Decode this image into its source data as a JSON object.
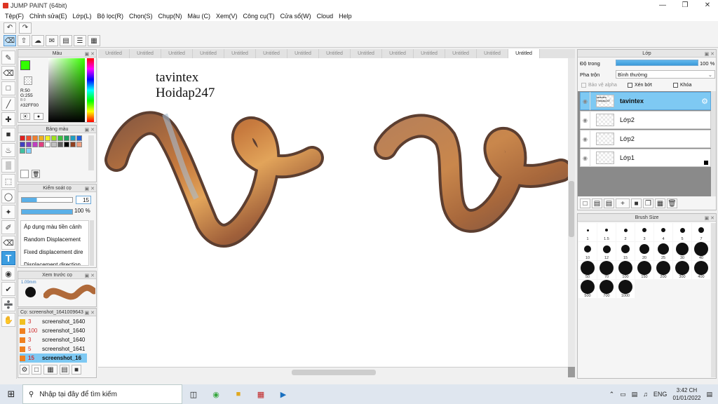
{
  "window": {
    "title": "JUMP PAINT (64bit)"
  },
  "menu": [
    "Tệp(F)",
    "Chỉnh sửa(E)",
    "Lớp(L)",
    "Bộ lọc(R)",
    "Chọn(S)",
    "Chụp(N)",
    "Màu (C)",
    "Xem(V)",
    "Công cụ(T)",
    "Cửa sổ(W)",
    "Cloud",
    "Help"
  ],
  "colorPanel": {
    "title": "Màu",
    "r": "R:50",
    "g": "G:255",
    "b": "B:0",
    "hex": "#32FF00"
  },
  "swatchPanel": {
    "title": "Bảng màu",
    "swatches": [
      "#e02020",
      "#f05030",
      "#f08030",
      "#f0b020",
      "#f0f020",
      "#a0e020",
      "#40c040",
      "#20a060",
      "#20a0c0",
      "#2060e0",
      "#4040c0",
      "#8040c0",
      "#c040c0",
      "#e04080",
      "#ffffff",
      "#c0c0c0",
      "#606060",
      "#000000",
      "#904020",
      "#f0a080",
      "#40c0a0",
      "#80d0ff"
    ]
  },
  "brushControl": {
    "title": "Kiểm soát cọ",
    "size": "15",
    "opacity": "100 %",
    "options": [
      "Áp dụng màu tiền cảnh",
      "Random Displacement",
      "Fixed displacement dire",
      "Displacement direction"
    ]
  },
  "brushPreview": {
    "title": "Xem trước cọ",
    "size": "1.09mm"
  },
  "brushList": {
    "title": "Cọ: screenshot_1641009643",
    "items": [
      {
        "num": "3",
        "name": "screenshot_1640"
      },
      {
        "num": "100",
        "name": "screenshot_1640"
      },
      {
        "num": "3",
        "name": "screenshot_1640"
      },
      {
        "num": "5",
        "name": "screenshot_1641"
      },
      {
        "num": "15",
        "name": "screenshot_16"
      }
    ]
  },
  "tabs": [
    "Untitled",
    "Untitled",
    "Untitled",
    "Untitled",
    "Untitled",
    "Untitled",
    "Untitled",
    "Untitled",
    "Untitled",
    "Untitled",
    "Untitled",
    "Untitled",
    "Untitled",
    "Untitled"
  ],
  "canvas": {
    "line1": "tavintex",
    "line2": "Hoidap247"
  },
  "layerPanel": {
    "title": "Lớp",
    "opacityLabel": "Độ trong",
    "opacityValue": "100 %",
    "blendLabel": "Pha trộn",
    "blendValue": "Bình thường",
    "protectAlpha": "Bảo vệ alpha",
    "clip": "Xén bớt",
    "lock": "Khóa",
    "layers": [
      {
        "name": "tavintex",
        "thumb": "tavintex Hoidap247",
        "selected": true
      },
      {
        "name": "Lớp2",
        "selected": false
      },
      {
        "name": "Lớp2",
        "selected": false
      },
      {
        "name": "Lớp1",
        "selected": false
      }
    ]
  },
  "brushSize": {
    "title": "Brush Size",
    "sizes": [
      "1",
      "1.5",
      "2",
      "3",
      "4",
      "5",
      "7",
      "10",
      "12",
      "15",
      "20",
      "25",
      "30",
      "40",
      "50",
      "70",
      "100",
      "150",
      "200",
      "300",
      "400",
      "500",
      "700",
      "1000"
    ]
  },
  "taskbar": {
    "search": "Nhập tại đây để tìm kiếm",
    "lang": "ENG",
    "time": "3:42 CH",
    "date": "01/01/2022"
  }
}
